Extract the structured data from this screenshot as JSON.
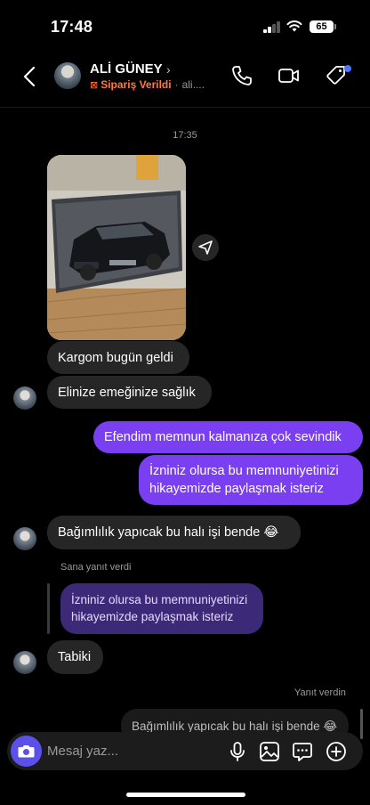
{
  "status_bar": {
    "time": "17:48",
    "battery": "65"
  },
  "header": {
    "name": "ALİ GÜNEY",
    "order_status": "Sipariş Verildi",
    "subtitle": "ali...."
  },
  "chat": {
    "timestamp": "17:35",
    "messages": [
      {
        "text": "Kargom bugün geldi"
      },
      {
        "text": "Elinize emeğinize sağlık"
      },
      {
        "text": "Efendim memnun kalmanıza çok sevindik"
      },
      {
        "line1": "İzniniz olursa bu memnuniyetinizi",
        "line2": "hikayemizde paylaşmak isteriz"
      },
      {
        "text": "Bağımlılık yapıcak bu halı işi bende 😂"
      },
      {
        "text": "Tabiki"
      }
    ],
    "reply_received": {
      "label": "Sana yanıt verdi",
      "quoted_line1": "İzniniz olursa bu memnuniyetinizi",
      "quoted_line2": "hikayemizde paylaşmak isteriz"
    },
    "reply_sent": {
      "label": "Yanıt verdin",
      "quoted": "Bağımlılık yapıcak bu halı işi bende 😂"
    }
  },
  "composer": {
    "placeholder": "Mesaj yaz..."
  },
  "colors": {
    "outgoing": "#7b3ff2",
    "incoming": "#262626",
    "accent_orange": "#ff7a3c",
    "camera": "#5b51e8"
  },
  "icons": [
    "back-icon",
    "phone-icon",
    "video-icon",
    "tag-icon",
    "share-icon",
    "camera-icon",
    "mic-icon",
    "gallery-icon",
    "sticker-icon",
    "plus-icon"
  ]
}
